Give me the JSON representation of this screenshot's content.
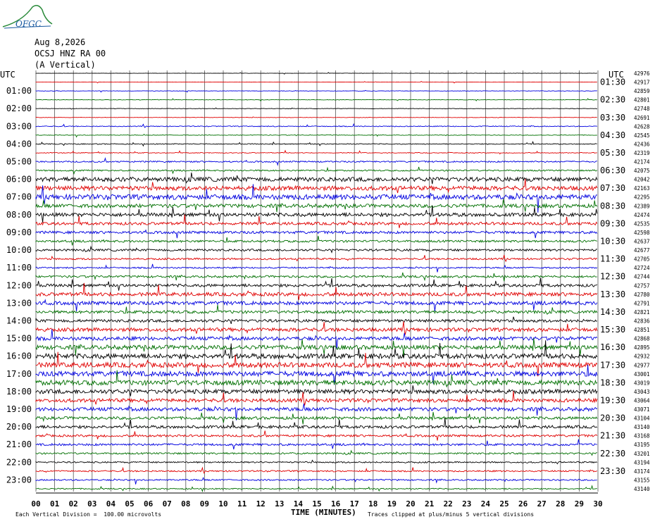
{
  "header": {
    "logo_text": "OFGC",
    "date": "Aug 8,2026",
    "station": "OCSJ HNZ RA 00",
    "component": "(A Vertical)"
  },
  "axis": {
    "left_title": "UTC",
    "right_title": "UTC",
    "xlabel": "TIME (MINUTES)",
    "footer_left": "Each Vertical Division =  100.00 microvolts",
    "footer_right": "Traces clipped at plus/minus 5 vertical divisions"
  },
  "chart_data": {
    "type": "line",
    "title": "",
    "xlabel": "TIME (MINUTES)",
    "xlim": [
      0,
      30
    ],
    "x_ticks": [
      "00",
      "01",
      "02",
      "03",
      "04",
      "05",
      "06",
      "07",
      "08",
      "09",
      "10",
      "11",
      "12",
      "13",
      "14",
      "15",
      "16",
      "17",
      "18",
      "19",
      "20",
      "21",
      "22",
      "23",
      "24",
      "25",
      "26",
      "27",
      "28",
      "29",
      "30"
    ],
    "left_hour_labels": [
      "01:00",
      "02:00",
      "03:00",
      "04:00",
      "05:00",
      "06:00",
      "07:00",
      "08:00",
      "09:00",
      "10:00",
      "11:00",
      "12:00",
      "13:00",
      "14:00",
      "15:00",
      "16:00",
      "17:00",
      "18:00",
      "19:00",
      "20:00",
      "21:00",
      "22:00",
      "23:00"
    ],
    "right_hour_labels": [
      "01:30",
      "02:30",
      "03:30",
      "04:30",
      "05:30",
      "06:30",
      "07:30",
      "08:30",
      "09:30",
      "10:30",
      "11:30",
      "12:30",
      "13:30",
      "14:30",
      "15:30",
      "16:30",
      "17:30",
      "18:30",
      "19:30",
      "20:30",
      "21:30",
      "22:30",
      "23:30"
    ],
    "trace_counts": [
      "42976",
      "42917",
      "42859",
      "42801",
      "42748",
      "42691",
      "42628",
      "42545",
      "42436",
      "42319",
      "42174",
      "42075",
      "42042",
      "42163",
      "42295",
      "42389",
      "42474",
      "42535",
      "42598",
      "42637",
      "42677",
      "42705",
      "42724",
      "42744",
      "42757",
      "42780",
      "42791",
      "42821",
      "42836",
      "42851",
      "42868",
      "42895",
      "42932",
      "42977",
      "43001",
      "43019",
      "43043",
      "43064",
      "43071",
      "43104",
      "43140",
      "43168",
      "43195",
      "43201",
      "43194",
      "43174",
      "43155",
      "43140"
    ],
    "trace_colors": [
      "#000000",
      "#e00000",
      "#0000e0",
      "#007000"
    ],
    "trace_amplitude": [
      0.2,
      0.2,
      0.3,
      0.3,
      0.3,
      0.3,
      0.6,
      0.4,
      0.6,
      0.5,
      1.0,
      1.0,
      3.0,
      3.0,
      3.5,
      2.5,
      2.5,
      2.0,
      1.8,
      1.5,
      1.5,
      1.2,
      1.0,
      1.5,
      2.0,
      2.5,
      2.5,
      2.0,
      2.0,
      2.5,
      2.5,
      3.0,
      3.5,
      3.5,
      3.5,
      3.5,
      3.0,
      2.5,
      2.5,
      2.0,
      2.0,
      1.5,
      1.5,
      1.2,
      1.0,
      1.0,
      1.0,
      0.8
    ],
    "grid": true
  }
}
